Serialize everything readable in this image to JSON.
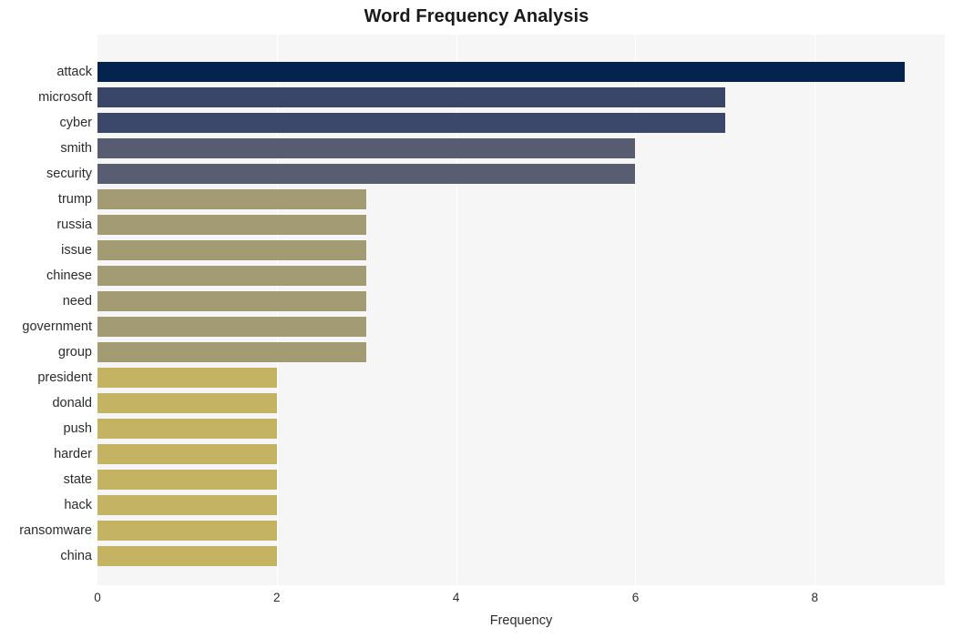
{
  "chart_data": {
    "type": "bar",
    "orientation": "horizontal",
    "title": "Word Frequency Analysis",
    "xlabel": "Frequency",
    "ylabel": "",
    "xlim": [
      0,
      9.45
    ],
    "xticks": [
      0,
      2,
      4,
      6,
      8
    ],
    "xtick_labels": [
      "0",
      "2",
      "4",
      "6",
      "8"
    ],
    "grid": "vertical",
    "legend": "none",
    "categories": [
      "attack",
      "microsoft",
      "cyber",
      "smith",
      "security",
      "trump",
      "russia",
      "issue",
      "chinese",
      "need",
      "government",
      "group",
      "president",
      "donald",
      "push",
      "harder",
      "state",
      "hack",
      "ransomware",
      "china"
    ],
    "values": [
      9,
      7,
      7,
      6,
      6,
      3,
      3,
      3,
      3,
      3,
      3,
      3,
      2,
      2,
      2,
      2,
      2,
      2,
      2,
      2
    ],
    "bar_colors": [
      "#04234f",
      "#3a4668",
      "#3c486b",
      "#575c70",
      "#595d72",
      "#a39b73",
      "#a39b73",
      "#a39b73",
      "#a39b73",
      "#a39b73",
      "#a39b73",
      "#a39b73",
      "#c3b363",
      "#c3b363",
      "#c3b363",
      "#c3b363",
      "#c3b363",
      "#c3b363",
      "#c3b363",
      "#c3b363"
    ],
    "plot_background": "#f6f6f7",
    "figure_background": "#ffffff",
    "gridline_color": "#ffffff"
  }
}
